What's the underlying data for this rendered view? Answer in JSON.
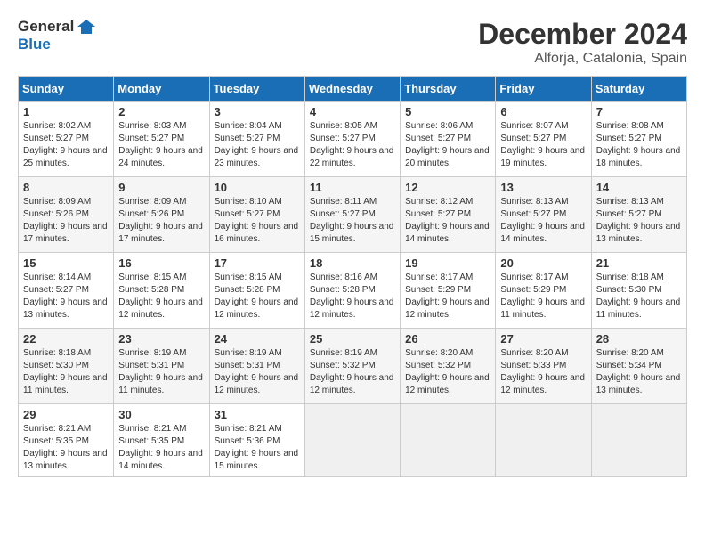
{
  "header": {
    "logo_line1": "General",
    "logo_line2": "Blue",
    "month": "December 2024",
    "location": "Alforja, Catalonia, Spain"
  },
  "weekdays": [
    "Sunday",
    "Monday",
    "Tuesday",
    "Wednesday",
    "Thursday",
    "Friday",
    "Saturday"
  ],
  "weeks": [
    [
      {
        "day": "1",
        "sunrise": "Sunrise: 8:02 AM",
        "sunset": "Sunset: 5:27 PM",
        "daylight": "Daylight: 9 hours and 25 minutes."
      },
      {
        "day": "2",
        "sunrise": "Sunrise: 8:03 AM",
        "sunset": "Sunset: 5:27 PM",
        "daylight": "Daylight: 9 hours and 24 minutes."
      },
      {
        "day": "3",
        "sunrise": "Sunrise: 8:04 AM",
        "sunset": "Sunset: 5:27 PM",
        "daylight": "Daylight: 9 hours and 23 minutes."
      },
      {
        "day": "4",
        "sunrise": "Sunrise: 8:05 AM",
        "sunset": "Sunset: 5:27 PM",
        "daylight": "Daylight: 9 hours and 22 minutes."
      },
      {
        "day": "5",
        "sunrise": "Sunrise: 8:06 AM",
        "sunset": "Sunset: 5:27 PM",
        "daylight": "Daylight: 9 hours and 20 minutes."
      },
      {
        "day": "6",
        "sunrise": "Sunrise: 8:07 AM",
        "sunset": "Sunset: 5:27 PM",
        "daylight": "Daylight: 9 hours and 19 minutes."
      },
      {
        "day": "7",
        "sunrise": "Sunrise: 8:08 AM",
        "sunset": "Sunset: 5:27 PM",
        "daylight": "Daylight: 9 hours and 18 minutes."
      }
    ],
    [
      {
        "day": "8",
        "sunrise": "Sunrise: 8:09 AM",
        "sunset": "Sunset: 5:26 PM",
        "daylight": "Daylight: 9 hours and 17 minutes."
      },
      {
        "day": "9",
        "sunrise": "Sunrise: 8:09 AM",
        "sunset": "Sunset: 5:26 PM",
        "daylight": "Daylight: 9 hours and 17 minutes."
      },
      {
        "day": "10",
        "sunrise": "Sunrise: 8:10 AM",
        "sunset": "Sunset: 5:27 PM",
        "daylight": "Daylight: 9 hours and 16 minutes."
      },
      {
        "day": "11",
        "sunrise": "Sunrise: 8:11 AM",
        "sunset": "Sunset: 5:27 PM",
        "daylight": "Daylight: 9 hours and 15 minutes."
      },
      {
        "day": "12",
        "sunrise": "Sunrise: 8:12 AM",
        "sunset": "Sunset: 5:27 PM",
        "daylight": "Daylight: 9 hours and 14 minutes."
      },
      {
        "day": "13",
        "sunrise": "Sunrise: 8:13 AM",
        "sunset": "Sunset: 5:27 PM",
        "daylight": "Daylight: 9 hours and 14 minutes."
      },
      {
        "day": "14",
        "sunrise": "Sunrise: 8:13 AM",
        "sunset": "Sunset: 5:27 PM",
        "daylight": "Daylight: 9 hours and 13 minutes."
      }
    ],
    [
      {
        "day": "15",
        "sunrise": "Sunrise: 8:14 AM",
        "sunset": "Sunset: 5:27 PM",
        "daylight": "Daylight: 9 hours and 13 minutes."
      },
      {
        "day": "16",
        "sunrise": "Sunrise: 8:15 AM",
        "sunset": "Sunset: 5:28 PM",
        "daylight": "Daylight: 9 hours and 12 minutes."
      },
      {
        "day": "17",
        "sunrise": "Sunrise: 8:15 AM",
        "sunset": "Sunset: 5:28 PM",
        "daylight": "Daylight: 9 hours and 12 minutes."
      },
      {
        "day": "18",
        "sunrise": "Sunrise: 8:16 AM",
        "sunset": "Sunset: 5:28 PM",
        "daylight": "Daylight: 9 hours and 12 minutes."
      },
      {
        "day": "19",
        "sunrise": "Sunrise: 8:17 AM",
        "sunset": "Sunset: 5:29 PM",
        "daylight": "Daylight: 9 hours and 12 minutes."
      },
      {
        "day": "20",
        "sunrise": "Sunrise: 8:17 AM",
        "sunset": "Sunset: 5:29 PM",
        "daylight": "Daylight: 9 hours and 11 minutes."
      },
      {
        "day": "21",
        "sunrise": "Sunrise: 8:18 AM",
        "sunset": "Sunset: 5:30 PM",
        "daylight": "Daylight: 9 hours and 11 minutes."
      }
    ],
    [
      {
        "day": "22",
        "sunrise": "Sunrise: 8:18 AM",
        "sunset": "Sunset: 5:30 PM",
        "daylight": "Daylight: 9 hours and 11 minutes."
      },
      {
        "day": "23",
        "sunrise": "Sunrise: 8:19 AM",
        "sunset": "Sunset: 5:31 PM",
        "daylight": "Daylight: 9 hours and 11 minutes."
      },
      {
        "day": "24",
        "sunrise": "Sunrise: 8:19 AM",
        "sunset": "Sunset: 5:31 PM",
        "daylight": "Daylight: 9 hours and 12 minutes."
      },
      {
        "day": "25",
        "sunrise": "Sunrise: 8:19 AM",
        "sunset": "Sunset: 5:32 PM",
        "daylight": "Daylight: 9 hours and 12 minutes."
      },
      {
        "day": "26",
        "sunrise": "Sunrise: 8:20 AM",
        "sunset": "Sunset: 5:32 PM",
        "daylight": "Daylight: 9 hours and 12 minutes."
      },
      {
        "day": "27",
        "sunrise": "Sunrise: 8:20 AM",
        "sunset": "Sunset: 5:33 PM",
        "daylight": "Daylight: 9 hours and 12 minutes."
      },
      {
        "day": "28",
        "sunrise": "Sunrise: 8:20 AM",
        "sunset": "Sunset: 5:34 PM",
        "daylight": "Daylight: 9 hours and 13 minutes."
      }
    ],
    [
      {
        "day": "29",
        "sunrise": "Sunrise: 8:21 AM",
        "sunset": "Sunset: 5:35 PM",
        "daylight": "Daylight: 9 hours and 13 minutes."
      },
      {
        "day": "30",
        "sunrise": "Sunrise: 8:21 AM",
        "sunset": "Sunset: 5:35 PM",
        "daylight": "Daylight: 9 hours and 14 minutes."
      },
      {
        "day": "31",
        "sunrise": "Sunrise: 8:21 AM",
        "sunset": "Sunset: 5:36 PM",
        "daylight": "Daylight: 9 hours and 15 minutes."
      },
      null,
      null,
      null,
      null
    ]
  ]
}
